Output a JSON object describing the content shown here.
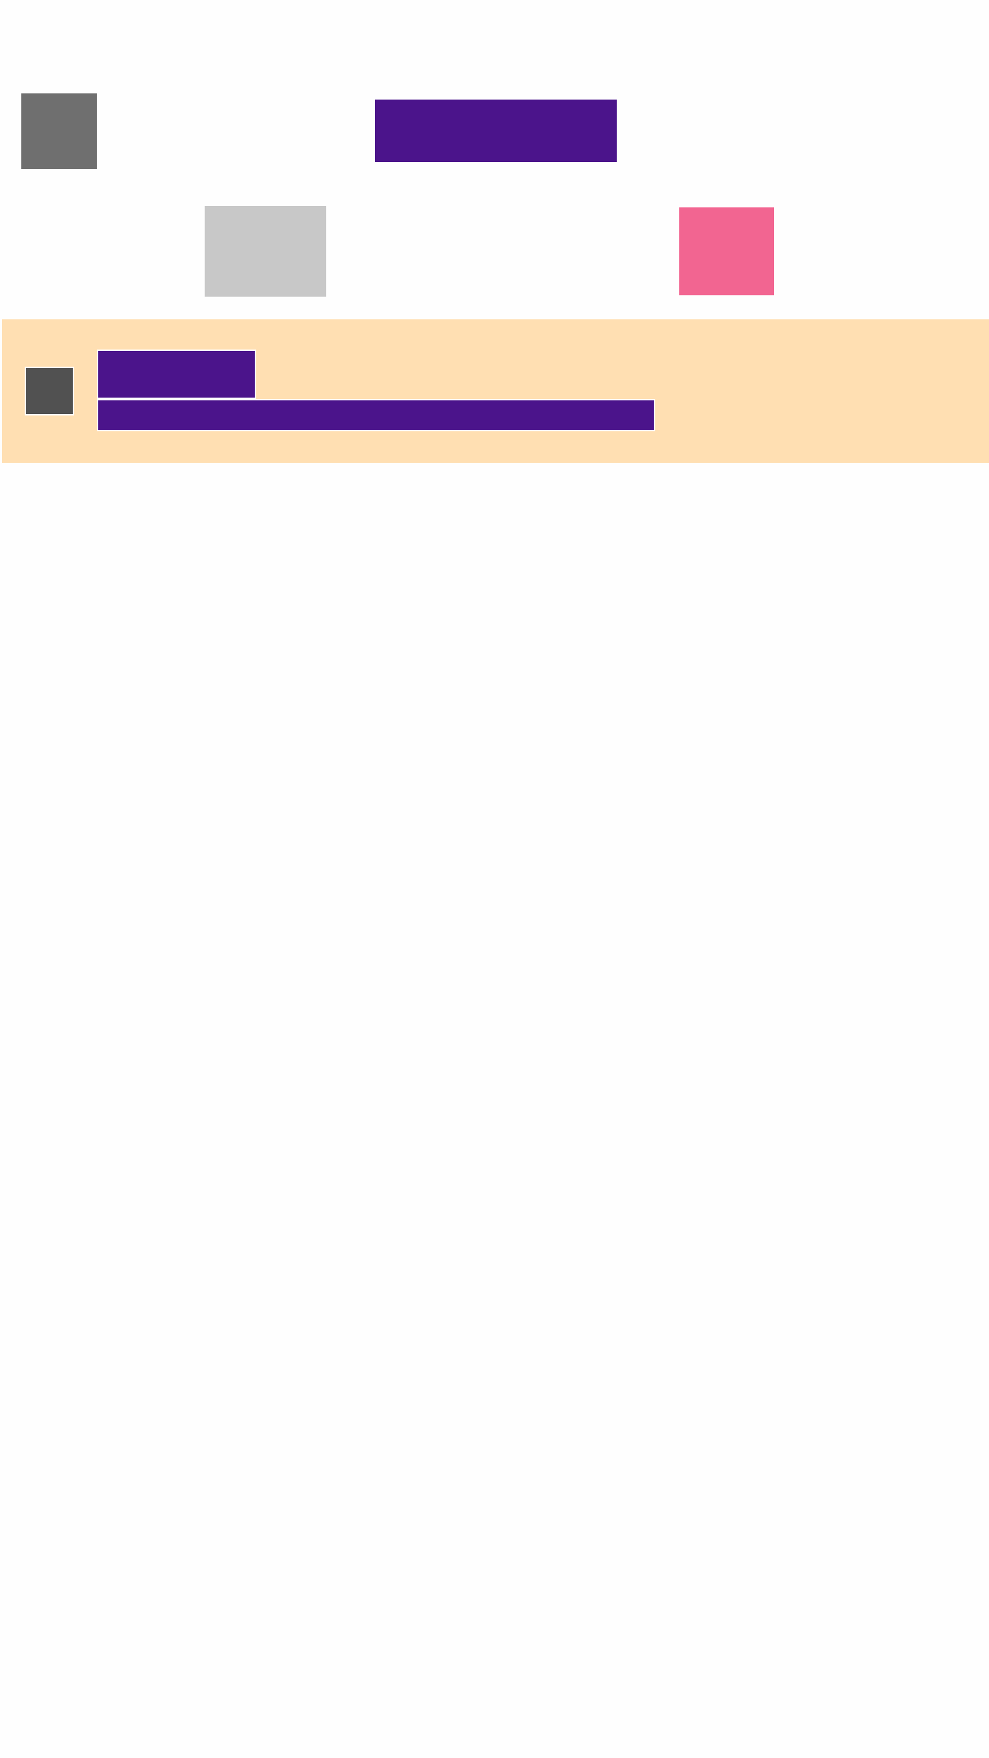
{
  "colors": {
    "background": "#FEFEFE",
    "header_icon": "#6F6F6F",
    "primary": "#4B148B",
    "secondary_block": "#C8C8C8",
    "accent_pink": "#F26591",
    "banner_background": "#FFDFB2",
    "banner_icon": "#515151"
  },
  "icons": {
    "back": "back-icon",
    "banner": "info-icon"
  }
}
